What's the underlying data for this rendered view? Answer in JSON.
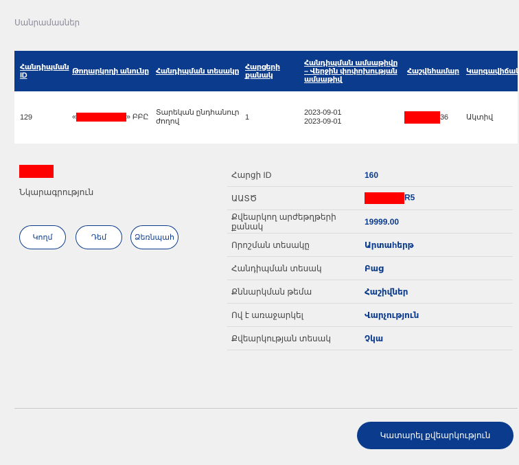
{
  "breadcrumb": "Սանրամասներ",
  "table": {
    "headers": [
      "Հանդիպման ID",
      "Թողարկողի անունը",
      "Հանդիպման տեսակը",
      "Հարցերի քանակ",
      "Հանդիպման ամսաթիվը – Վերջին փոփոխության ամսաթիվ",
      "Հաշվեհամար",
      "Կարգավիճակ"
    ],
    "row": {
      "id": "129",
      "issuer_prefix": "«",
      "issuer_suffix": "» ԲԲԸ",
      "type": "Տարեկան ընդհանուր ժողով",
      "questions": "1",
      "date1": "2023-09-01",
      "date2": "2023-09-01",
      "account_suffix": "36",
      "status": "Ակտիվ"
    }
  },
  "left": {
    "description_label": "Նկարագրություն",
    "buttons": [
      "Կողմ",
      "Դեմ",
      "Ձեռնպահ"
    ]
  },
  "properties": [
    {
      "label": "Հարցի ID",
      "value": "160"
    },
    {
      "label": "ԱԱՏԾ",
      "value": "R5"
    },
    {
      "label": "Քվեարկող արժեթղթերի քանակ",
      "value": "19999.00"
    },
    {
      "label": "Որոշման տեսակը",
      "value": "Արտաhերթ"
    },
    {
      "label": "Հանդիպման տեսակ",
      "value": "Բաց"
    },
    {
      "label": "Քննարկման թեմա",
      "value": "Հաշիվներ"
    },
    {
      "label": "Ով է առաջարկել",
      "value": "Վարչություն"
    },
    {
      "label": "Քվեարկության տեսակ",
      "value": "Չկա"
    }
  ],
  "primary_button": "Կատարել քվեարկություն",
  "colors": {
    "primary": "#0b3b8c",
    "redaction": "#ff0000",
    "background": "#f0f0f0"
  }
}
